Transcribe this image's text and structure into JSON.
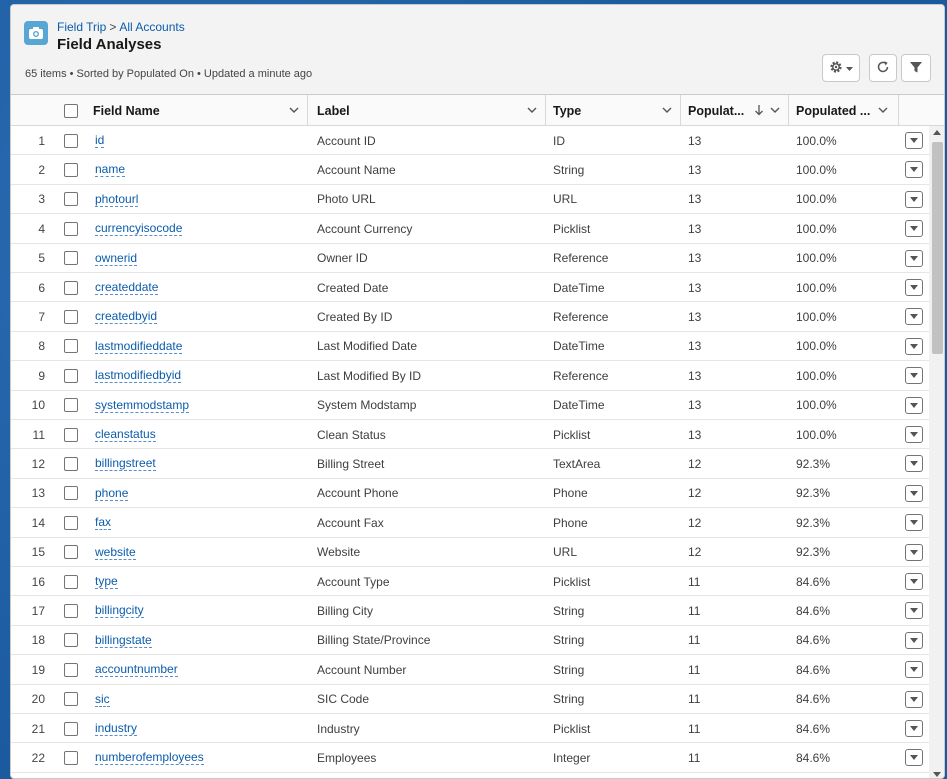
{
  "header": {
    "breadcrumb_parent": "Field Trip",
    "breadcrumb_sep": ">",
    "breadcrumb_current": "All Accounts",
    "title": "Field Analyses",
    "meta": "65 items • Sorted by Populated On • Updated a minute ago",
    "icon": "camera-icon"
  },
  "toolbar": {
    "settings_icon": "gear-icon",
    "refresh_icon": "refresh-icon",
    "filter_icon": "filter-icon"
  },
  "columns": {
    "field_name": "Field Name",
    "label": "Label",
    "type": "Type",
    "populated_on": "Populat...",
    "populated_pct": "Populated ..."
  },
  "colors": {
    "link": "#0b5cab",
    "header_bg": "#f3f3f3",
    "app_icon": "#58a6d4"
  },
  "rows": [
    {
      "num": "1",
      "field": "id",
      "label": "Account ID",
      "type": "ID",
      "pop": "13",
      "pct": "100.0%"
    },
    {
      "num": "2",
      "field": "name",
      "label": "Account Name",
      "type": "String",
      "pop": "13",
      "pct": "100.0%"
    },
    {
      "num": "3",
      "field": "photourl",
      "label": "Photo URL",
      "type": "URL",
      "pop": "13",
      "pct": "100.0%"
    },
    {
      "num": "4",
      "field": "currencyisocode",
      "label": "Account Currency",
      "type": "Picklist",
      "pop": "13",
      "pct": "100.0%"
    },
    {
      "num": "5",
      "field": "ownerid",
      "label": "Owner ID",
      "type": "Reference",
      "pop": "13",
      "pct": "100.0%"
    },
    {
      "num": "6",
      "field": "createddate",
      "label": "Created Date",
      "type": "DateTime",
      "pop": "13",
      "pct": "100.0%"
    },
    {
      "num": "7",
      "field": "createdbyid",
      "label": "Created By ID",
      "type": "Reference",
      "pop": "13",
      "pct": "100.0%"
    },
    {
      "num": "8",
      "field": "lastmodifieddate",
      "label": "Last Modified Date",
      "type": "DateTime",
      "pop": "13",
      "pct": "100.0%"
    },
    {
      "num": "9",
      "field": "lastmodifiedbyid",
      "label": "Last Modified By ID",
      "type": "Reference",
      "pop": "13",
      "pct": "100.0%"
    },
    {
      "num": "10",
      "field": "systemmodstamp",
      "label": "System Modstamp",
      "type": "DateTime",
      "pop": "13",
      "pct": "100.0%"
    },
    {
      "num": "11",
      "field": "cleanstatus",
      "label": "Clean Status",
      "type": "Picklist",
      "pop": "13",
      "pct": "100.0%"
    },
    {
      "num": "12",
      "field": "billingstreet",
      "label": "Billing Street",
      "type": "TextArea",
      "pop": "12",
      "pct": "92.3%"
    },
    {
      "num": "13",
      "field": "phone",
      "label": "Account Phone",
      "type": "Phone",
      "pop": "12",
      "pct": "92.3%"
    },
    {
      "num": "14",
      "field": "fax",
      "label": "Account Fax",
      "type": "Phone",
      "pop": "12",
      "pct": "92.3%"
    },
    {
      "num": "15",
      "field": "website",
      "label": "Website",
      "type": "URL",
      "pop": "12",
      "pct": "92.3%"
    },
    {
      "num": "16",
      "field": "type",
      "label": "Account Type",
      "type": "Picklist",
      "pop": "11",
      "pct": "84.6%"
    },
    {
      "num": "17",
      "field": "billingcity",
      "label": "Billing City",
      "type": "String",
      "pop": "11",
      "pct": "84.6%"
    },
    {
      "num": "18",
      "field": "billingstate",
      "label": "Billing State/Province",
      "type": "String",
      "pop": "11",
      "pct": "84.6%"
    },
    {
      "num": "19",
      "field": "accountnumber",
      "label": "Account Number",
      "type": "String",
      "pop": "11",
      "pct": "84.6%"
    },
    {
      "num": "20",
      "field": "sic",
      "label": "SIC Code",
      "type": "String",
      "pop": "11",
      "pct": "84.6%"
    },
    {
      "num": "21",
      "field": "industry",
      "label": "Industry",
      "type": "Picklist",
      "pop": "11",
      "pct": "84.6%"
    },
    {
      "num": "22",
      "field": "numberofemployees",
      "label": "Employees",
      "type": "Integer",
      "pop": "11",
      "pct": "84.6%"
    }
  ]
}
